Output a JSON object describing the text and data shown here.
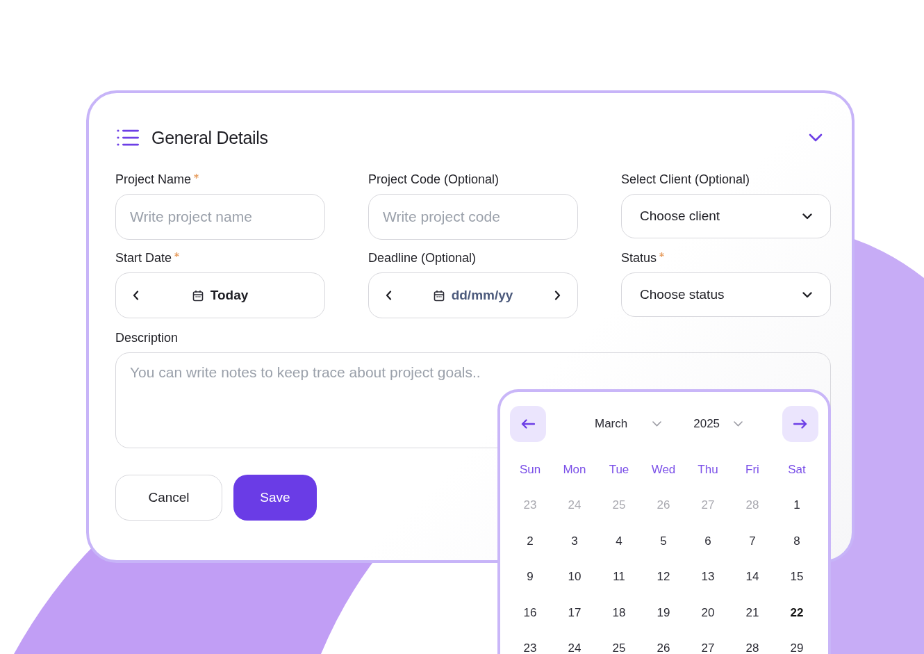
{
  "section": {
    "title": "General Details"
  },
  "fields": [
    {
      "kind": "text",
      "label": "Project Name",
      "required": true,
      "placeholder": "Write project name"
    },
    {
      "kind": "text",
      "label": "Project Code (Optional)",
      "required": false,
      "placeholder": "Write project code"
    },
    {
      "kind": "select",
      "label": "Select Client (Optional)",
      "required": false,
      "value": "Choose client"
    },
    {
      "kind": "date",
      "label": "Start Date",
      "required": true,
      "value": "Today",
      "next_arrow": false
    },
    {
      "kind": "date",
      "label": "Deadline (Optional)",
      "required": false,
      "placeholder": "dd/mm/yy",
      "next_arrow": true
    },
    {
      "kind": "select",
      "label": "Status",
      "required": true,
      "value": "Choose status"
    }
  ],
  "description": {
    "label": "Description",
    "placeholder": "You can write notes to keep trace about project goals.."
  },
  "buttons": [
    {
      "kind": "secondary",
      "label": "Cancel"
    },
    {
      "kind": "primary",
      "label": "Save"
    }
  ],
  "calendar": {
    "month": "March",
    "year": "2025",
    "weekdays": [
      "Sun",
      "Mon",
      "Tue",
      "Wed",
      "Thu",
      "Fri",
      "Sat"
    ],
    "days": [
      {
        "day": "23",
        "outside_month": true,
        "today": false
      },
      {
        "day": "24",
        "outside_month": true,
        "today": false
      },
      {
        "day": "25",
        "outside_month": true,
        "today": false
      },
      {
        "day": "26",
        "outside_month": true,
        "today": false
      },
      {
        "day": "27",
        "outside_month": true,
        "today": false
      },
      {
        "day": "28",
        "outside_month": true,
        "today": false
      },
      {
        "day": "1",
        "outside_month": false,
        "today": false
      },
      {
        "day": "2",
        "outside_month": false,
        "today": false
      },
      {
        "day": "3",
        "outside_month": false,
        "today": false
      },
      {
        "day": "4",
        "outside_month": false,
        "today": false
      },
      {
        "day": "5",
        "outside_month": false,
        "today": false
      },
      {
        "day": "6",
        "outside_month": false,
        "today": false
      },
      {
        "day": "7",
        "outside_month": false,
        "today": false
      },
      {
        "day": "8",
        "outside_month": false,
        "today": false
      },
      {
        "day": "9",
        "outside_month": false,
        "today": false
      },
      {
        "day": "10",
        "outside_month": false,
        "today": false
      },
      {
        "day": "11",
        "outside_month": false,
        "today": false
      },
      {
        "day": "12",
        "outside_month": false,
        "today": false
      },
      {
        "day": "13",
        "outside_month": false,
        "today": false
      },
      {
        "day": "14",
        "outside_month": false,
        "today": false
      },
      {
        "day": "15",
        "outside_month": false,
        "today": false
      },
      {
        "day": "16",
        "outside_month": false,
        "today": false
      },
      {
        "day": "17",
        "outside_month": false,
        "today": false
      },
      {
        "day": "18",
        "outside_month": false,
        "today": false
      },
      {
        "day": "19",
        "outside_month": false,
        "today": false
      },
      {
        "day": "20",
        "outside_month": false,
        "today": false
      },
      {
        "day": "21",
        "outside_month": false,
        "today": false
      },
      {
        "day": "22",
        "outside_month": false,
        "today": true
      },
      {
        "day": "23",
        "outside_month": false,
        "today": false
      },
      {
        "day": "24",
        "outside_month": false,
        "today": false
      },
      {
        "day": "25",
        "outside_month": false,
        "today": false
      },
      {
        "day": "26",
        "outside_month": false,
        "today": false
      },
      {
        "day": "27",
        "outside_month": false,
        "today": false
      },
      {
        "day": "28",
        "outside_month": false,
        "today": false
      },
      {
        "day": "29",
        "outside_month": false,
        "today": false
      }
    ]
  }
}
